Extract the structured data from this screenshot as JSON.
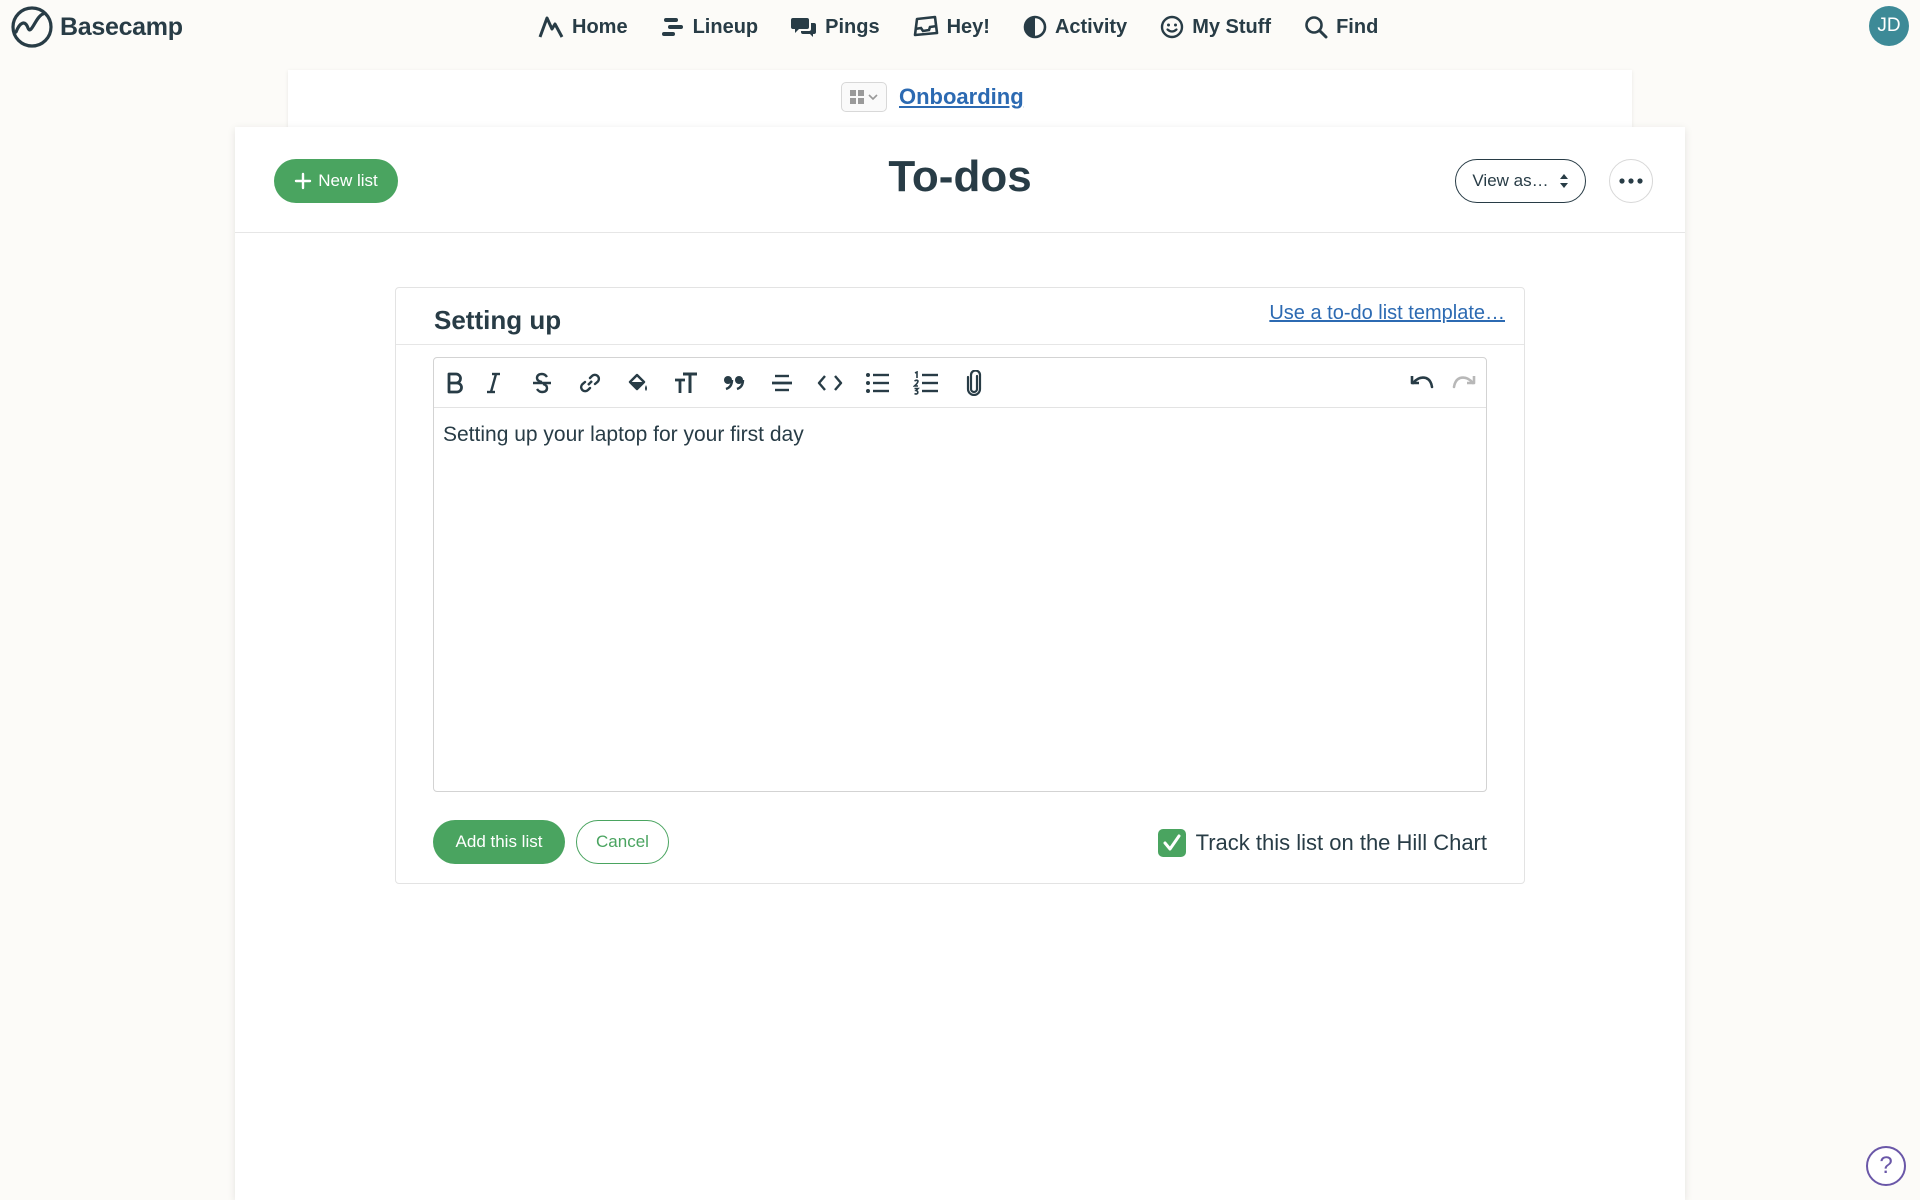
{
  "brand": {
    "name": "Basecamp",
    "logo_icon": "basecamp-logo-icon"
  },
  "nav": {
    "items": [
      {
        "label": "Home",
        "icon": "home-icon"
      },
      {
        "label": "Lineup",
        "icon": "lineup-icon"
      },
      {
        "label": "Pings",
        "icon": "chat-bubbles-icon"
      },
      {
        "label": "Hey!",
        "icon": "inbox-tray-icon"
      },
      {
        "label": "Activity",
        "icon": "half-circle-icon"
      },
      {
        "label": "My Stuff",
        "icon": "smiley-icon"
      },
      {
        "label": "Find",
        "icon": "search-icon"
      }
    ],
    "avatar_initials": "JD"
  },
  "project": {
    "name": "Onboarding"
  },
  "header": {
    "new_list_label": "New list",
    "title": "To-dos",
    "view_as_label": "View as…"
  },
  "form": {
    "list_name_value": "Setting up",
    "template_link_label": "Use a to-do list template…",
    "toolbar": [
      "bold-icon",
      "italic-icon",
      "strikethrough-icon",
      "link-icon",
      "highlight-icon",
      "text-size-icon",
      "quote-icon",
      "horizontal-rule-icon",
      "code-icon",
      "bulleted-list-icon",
      "numbered-list-icon",
      "attachment-icon",
      "undo-icon",
      "redo-icon"
    ],
    "description_value": "Setting up your laptop for your first day",
    "submit_label": "Add this list",
    "cancel_label": "Cancel",
    "hill_chart_label": "Track this list on the Hill Chart",
    "hill_chart_checked": true
  },
  "help": {
    "label": "?"
  },
  "colors": {
    "accent_green": "#4aa460",
    "link_blue": "#2c6ab2",
    "text_dark": "#283c46",
    "avatar_teal": "#3d8a97",
    "help_purple": "#6a57a8"
  }
}
